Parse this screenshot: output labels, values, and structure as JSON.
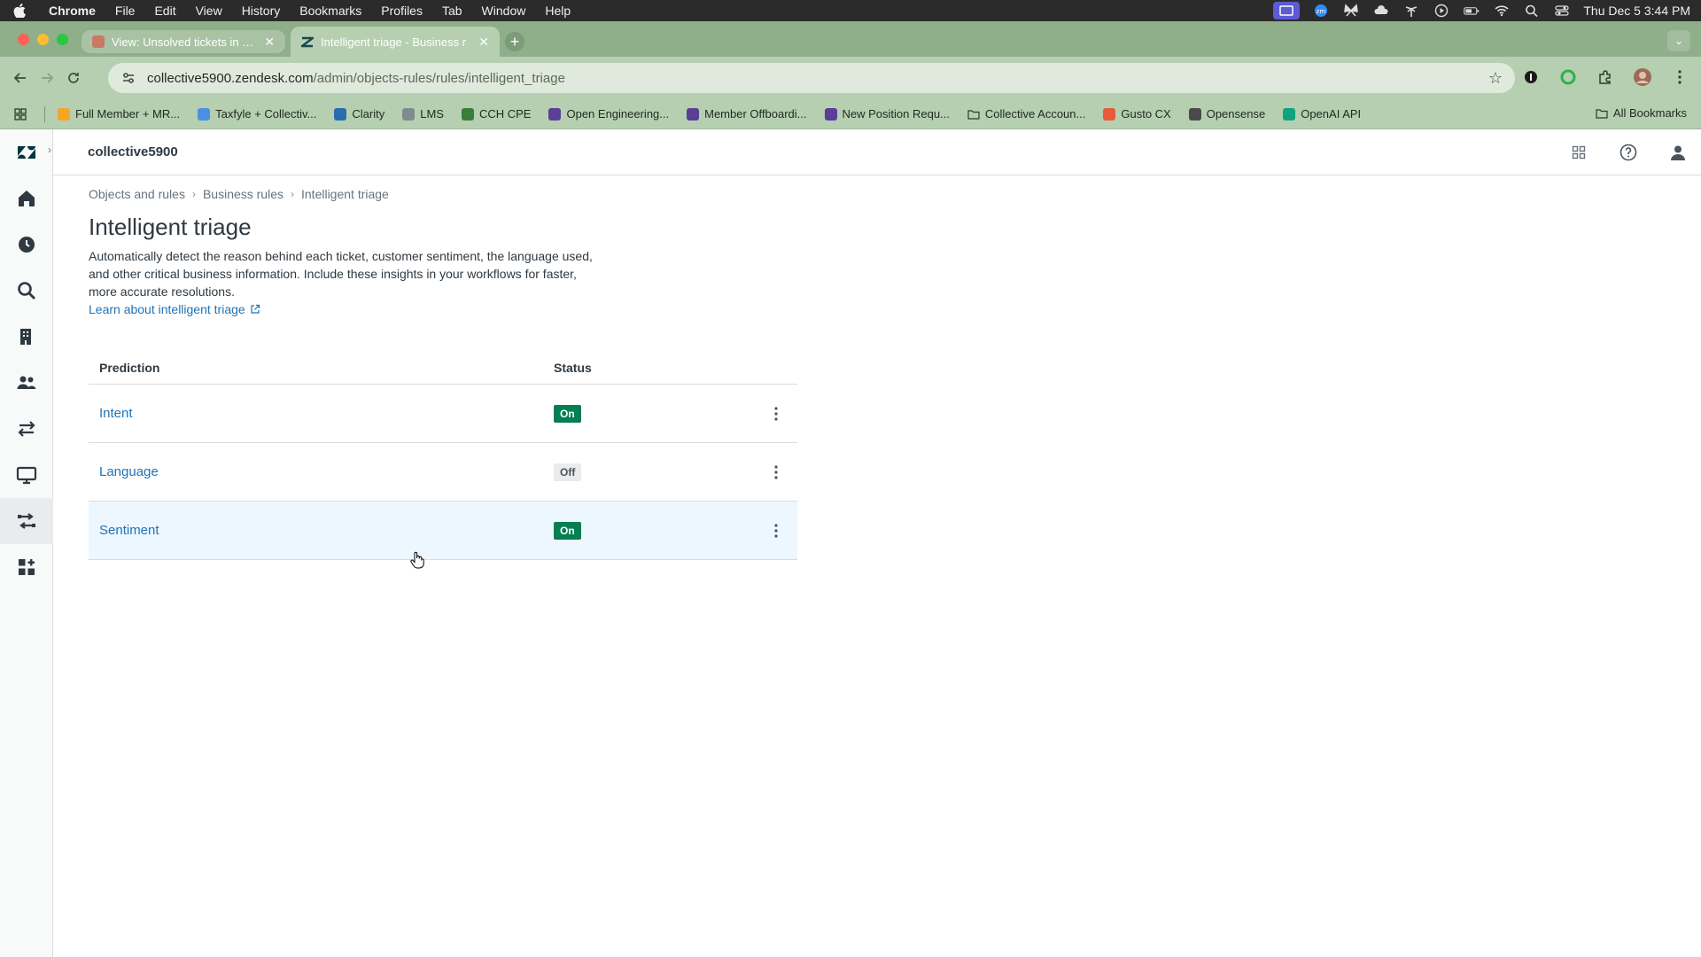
{
  "menubar": {
    "app": "Chrome",
    "items": [
      "File",
      "Edit",
      "View",
      "History",
      "Bookmarks",
      "Profiles",
      "Tab",
      "Window",
      "Help"
    ],
    "clock": "Thu Dec 5  3:44 PM"
  },
  "tabs": [
    {
      "title": "View: Unsolved tickets in your",
      "fav_color": "#c97a62"
    },
    {
      "title": "Intelligent triage - Business r",
      "fav_color": "#17494d"
    }
  ],
  "toolbar": {
    "url_host": "collective5900.zendesk.com",
    "url_path": "/admin/objects-rules/rules/intelligent_triage"
  },
  "bookmarks": [
    {
      "label": "Full Member + MR...",
      "color": "#f5a623"
    },
    {
      "label": "Taxfyle + Collectiv...",
      "color": "#4a90e2"
    },
    {
      "label": "Clarity",
      "color": "#2b6cb0"
    },
    {
      "label": "LMS",
      "color": "#7f8c8d"
    },
    {
      "label": "CCH CPE",
      "color": "#3b7d3b"
    },
    {
      "label": "Open Engineering...",
      "color": "#5b3e96"
    },
    {
      "label": "Member Offboardi...",
      "color": "#5b3e96"
    },
    {
      "label": "New Position Requ...",
      "color": "#5b3e96"
    },
    {
      "label": "Collective Accoun...",
      "color": "#6b7b68"
    },
    {
      "label": "Gusto CX",
      "color": "#e65c3b"
    },
    {
      "label": "Opensense",
      "color": "#4a4a4a"
    },
    {
      "label": "OpenAI API",
      "color": "#10a37f"
    }
  ],
  "all_bookmarks": "All Bookmarks",
  "header": {
    "org": "collective5900"
  },
  "breadcrumb": [
    "Objects and rules",
    "Business rules",
    "Intelligent triage"
  ],
  "page": {
    "title": "Intelligent triage",
    "description": "Automatically detect the reason behind each ticket, customer sentiment, the language used, and other critical business information. Include these insights in your workflows for faster, more accurate resolutions.",
    "learn_link": "Learn about intelligent triage"
  },
  "table": {
    "headers": {
      "prediction": "Prediction",
      "status": "Status"
    },
    "rows": [
      {
        "name": "Intent",
        "status": "On"
      },
      {
        "name": "Language",
        "status": "Off"
      },
      {
        "name": "Sentiment",
        "status": "On"
      }
    ]
  },
  "colors": {
    "brand_link": "#1f73b7",
    "status_on": "#037f52",
    "status_off_bg": "#e9ebed",
    "chrome_theme": "#b6cfb1"
  }
}
